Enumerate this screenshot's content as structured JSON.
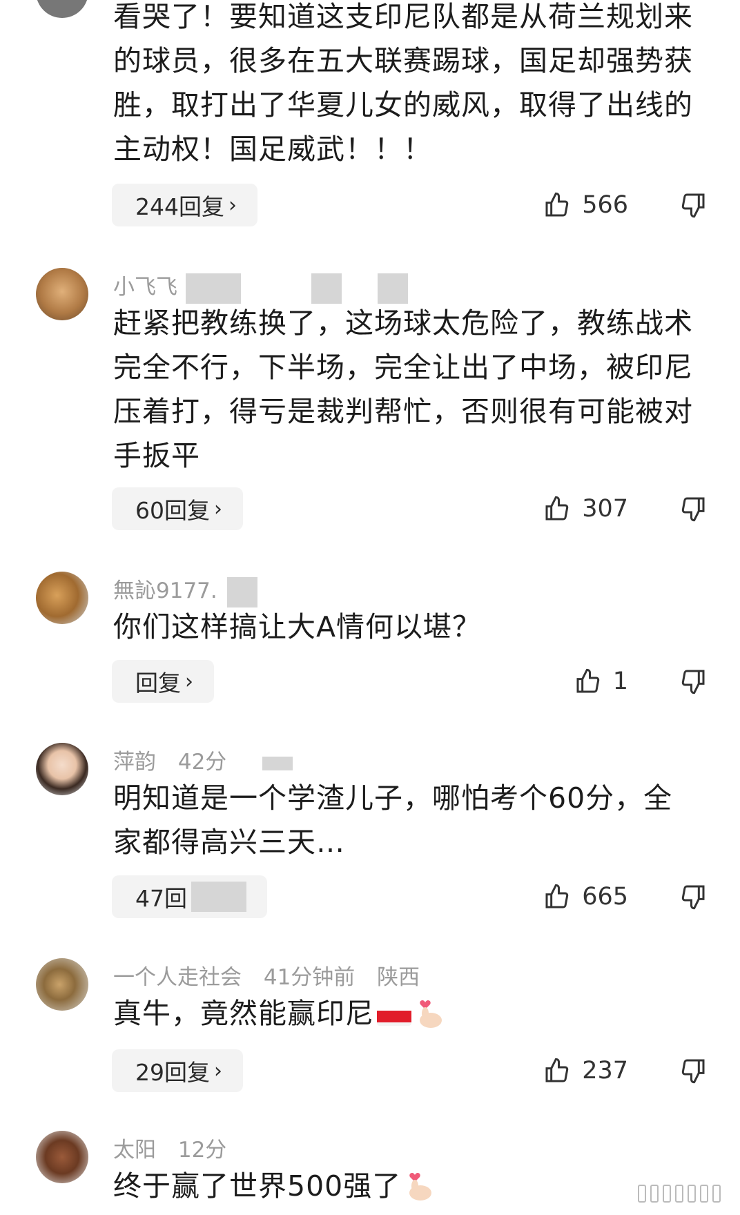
{
  "comments": [
    {
      "text": "看哭了！要知道这支印尼队都是从荷兰规划来的球员，很多在五大联赛踢球，国足却强势获胜，取打出了华夏儿女的威风，取得了出线的主动权！国足威武！！！",
      "reply_label": "244回复",
      "likes": "566"
    },
    {
      "username": "小飞飞",
      "text": "赶紧把教练换了，这场球太危险了，教练战术完全不行，下半场，完全让出了中场，被印尼压着打，得亏是裁判帮忙，否则很有可能被对手扳平",
      "reply_label": "60回复",
      "likes": "307"
    },
    {
      "username": "無訫9177.",
      "text": "你们这样搞让大A情何以堪？",
      "reply_label": "回复",
      "likes": "1"
    },
    {
      "username": "萍韵",
      "time": "42分",
      "text": "明知道是一个学渣儿子，哪怕考个60分，全家都得高兴三天…",
      "reply_label": "47回",
      "likes": "665"
    },
    {
      "username": "一个人走社会",
      "time": "41分钟前",
      "location": "陕西",
      "text": "真牛，竟然能赢印尼",
      "reply_label": "29回复",
      "likes": "237"
    },
    {
      "username": "太阳",
      "time": "12分",
      "text": "终于赢了世界500强了"
    }
  ],
  "icons": {
    "like": "thumbs-up-icon",
    "dislike": "thumbs-down-icon",
    "chevron": "chevron-right-icon"
  },
  "colors": {
    "meta": "#9b9b9b",
    "reply_bg": "#f3f3f3"
  }
}
